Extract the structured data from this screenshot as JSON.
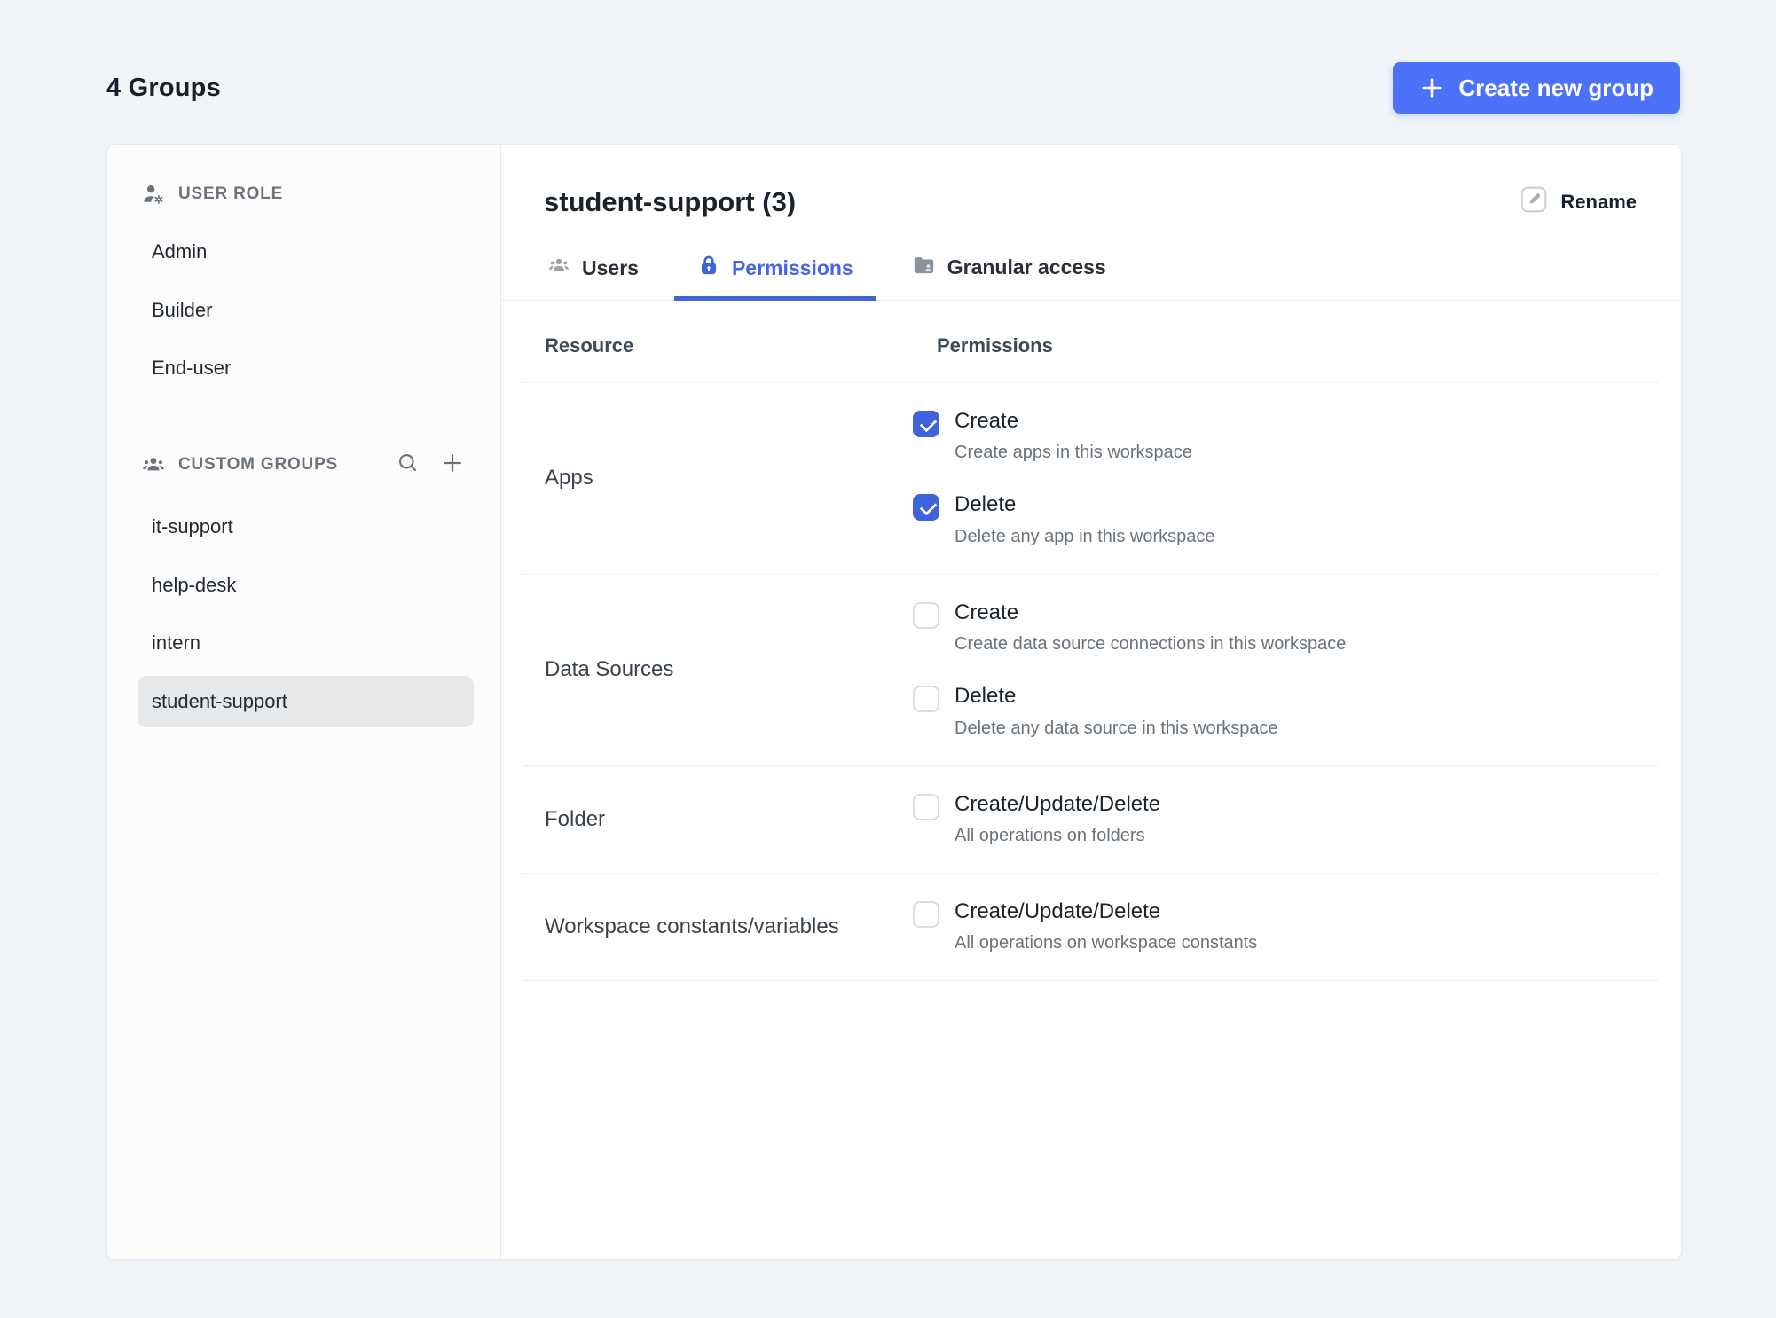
{
  "page": {
    "title": "4 Groups",
    "create_button_label": "Create new group"
  },
  "sidebar": {
    "user_role": {
      "header": "USER ROLE",
      "items": [
        {
          "label": "Admin",
          "selected": false
        },
        {
          "label": "Builder",
          "selected": false
        },
        {
          "label": "End-user",
          "selected": false
        }
      ]
    },
    "custom_groups": {
      "header": "CUSTOM GROUPS",
      "items": [
        {
          "label": "it-support",
          "selected": false
        },
        {
          "label": "help-desk",
          "selected": false
        },
        {
          "label": "intern",
          "selected": false
        },
        {
          "label": "student-support",
          "selected": true
        }
      ]
    }
  },
  "main": {
    "title": "student-support (3)",
    "rename_label": "Rename",
    "tabs": [
      {
        "label": "Users",
        "active": false
      },
      {
        "label": "Permissions",
        "active": true
      },
      {
        "label": "Granular access",
        "active": false
      }
    ],
    "table": {
      "columns": [
        "Resource",
        "Permissions"
      ],
      "rows": [
        {
          "resource": "Apps",
          "permissions": [
            {
              "label": "Create",
              "description": "Create apps in this workspace",
              "checked": true
            },
            {
              "label": "Delete",
              "description": "Delete any app in this workspace",
              "checked": true
            }
          ]
        },
        {
          "resource": "Data Sources",
          "permissions": [
            {
              "label": "Create",
              "description": "Create data source connections in this workspace",
              "checked": false
            },
            {
              "label": "Delete",
              "description": "Delete any data source in this workspace",
              "checked": false
            }
          ]
        },
        {
          "resource": "Folder",
          "permissions": [
            {
              "label": "Create/Update/Delete",
              "description": "All operations on folders",
              "checked": false
            }
          ]
        },
        {
          "resource": "Workspace constants/variables",
          "permissions": [
            {
              "label": "Create/Update/Delete",
              "description": "All operations on workspace constants",
              "checked": false
            }
          ]
        }
      ]
    }
  },
  "colors": {
    "primary_button": "#4D72FA",
    "accent_blue": "#3E63DD",
    "selected_item_bg": "#E6E8EA",
    "page_background": "#F1F5F9"
  }
}
